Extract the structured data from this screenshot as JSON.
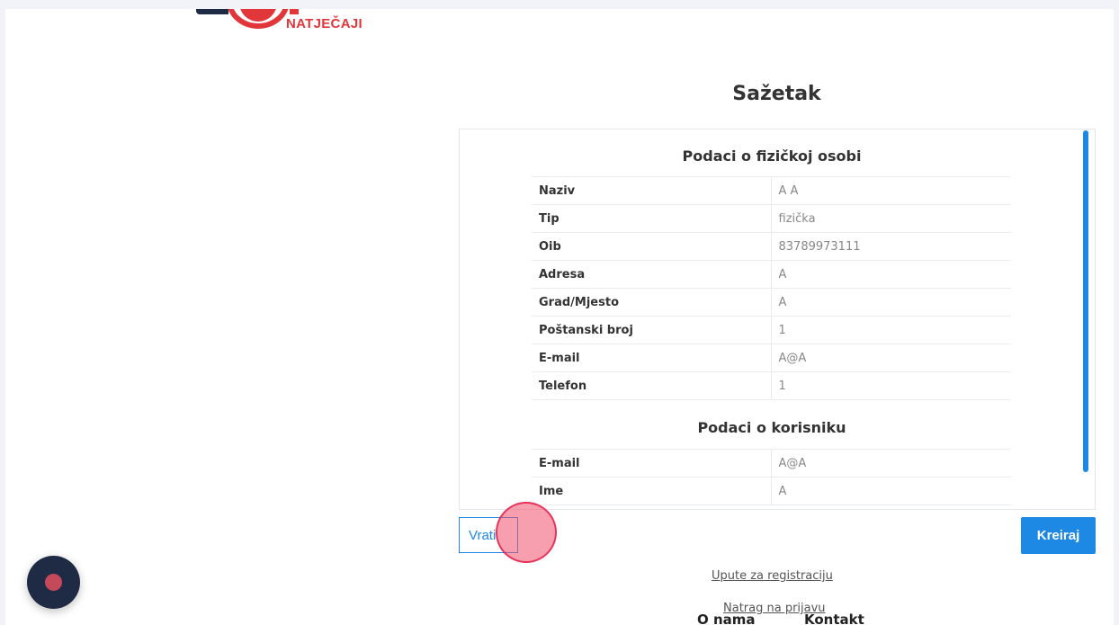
{
  "logo": {
    "text": "NATJEČAJI"
  },
  "page": {
    "title": "Sažetak"
  },
  "person_section": {
    "title": "Podaci o fizičkoj osobi",
    "rows": [
      {
        "label": "Naziv",
        "value": "A A"
      },
      {
        "label": "Tip",
        "value": "fizička"
      },
      {
        "label": "Oib",
        "value": "83789973111"
      },
      {
        "label": "Adresa",
        "value": "A"
      },
      {
        "label": "Grad/Mjesto",
        "value": "A"
      },
      {
        "label": "Poštanski broj",
        "value": "1"
      },
      {
        "label": "E-mail",
        "value": "A@A"
      },
      {
        "label": "Telefon",
        "value": "1"
      }
    ]
  },
  "user_section": {
    "title": "Podaci o korisniku",
    "rows": [
      {
        "label": "E-mail",
        "value": "A@A"
      },
      {
        "label": "Ime",
        "value": "A"
      }
    ]
  },
  "buttons": {
    "back": "Vrati",
    "create": "Kreiraj"
  },
  "links": {
    "guide": "Upute za registraciju",
    "back_to_login": "Natrag na prijavu"
  },
  "footer": {
    "about": "O nama",
    "contact": "Kontakt"
  },
  "colors": {
    "accent": "#1e88e5",
    "brand_red": "#e2373a",
    "dark_navy": "#1f2a44"
  },
  "icons": {
    "chat": "chat-bubble-icon"
  }
}
